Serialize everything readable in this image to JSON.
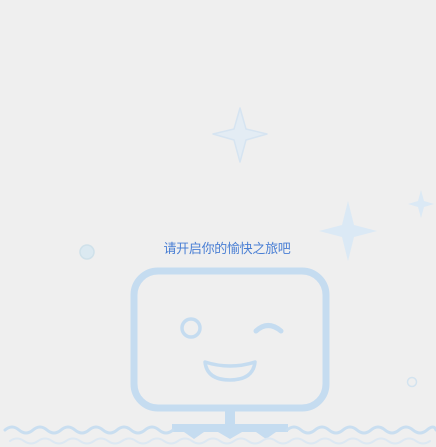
{
  "empty_state": {
    "message": "请开启你的愉快之旅吧",
    "illustration_icon": "smiling-tv-robot-icon"
  },
  "colors": {
    "background": "#efefef",
    "message_text": "#4a7fd4",
    "illustration_stroke": "#c5dcf0",
    "sparkle_fill": "#dbe9f5",
    "sparkle_fill_light": "#e3ecf4"
  }
}
